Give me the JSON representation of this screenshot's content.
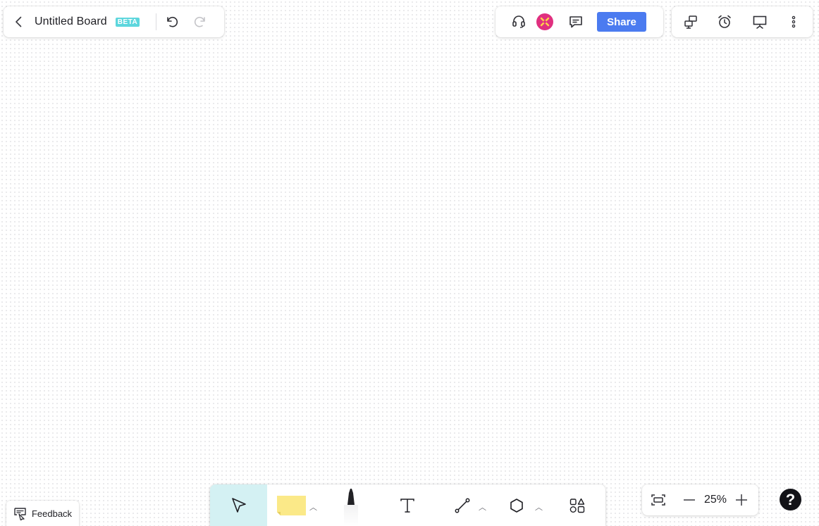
{
  "board": {
    "title": "Untitled Board",
    "badge": "BETA",
    "back_icon": "chevron-left-icon",
    "undo_icon": "undo-icon",
    "redo_icon": "redo-icon"
  },
  "collab": {
    "support_icon": "headset-icon",
    "avatar_icon": "avatar-icon",
    "comments_icon": "comment-icon",
    "share_label": "Share"
  },
  "tools_menu": {
    "icons": [
      "pin-transfer-icon",
      "alarm-clock-icon",
      "presentation-icon",
      "more-vertical-icon"
    ]
  },
  "toolbar": {
    "tools": [
      {
        "name": "select",
        "icon": "cursor-arrow-icon",
        "active": true
      },
      {
        "name": "sticky-note",
        "icon": "sticky-note-icon",
        "has_menu": true
      },
      {
        "name": "pen",
        "icon": "marker-icon"
      },
      {
        "name": "text",
        "icon": "text-icon"
      },
      {
        "name": "connector",
        "icon": "line-connector-icon",
        "has_menu": true
      },
      {
        "name": "shape",
        "icon": "hexagon-icon",
        "has_menu": true
      },
      {
        "name": "templates",
        "icon": "shapes-library-icon"
      }
    ]
  },
  "zoom": {
    "level": "25%",
    "fit_icon": "fit-to-screen-icon",
    "minus_icon": "minus-icon",
    "plus_icon": "plus-icon"
  },
  "help": {
    "label": "?"
  },
  "feedback": {
    "label": "Feedback",
    "icon": "feedback-icon"
  },
  "colors": {
    "accent": "#4b7bf0",
    "active_tool_bg": "#d4f1f3",
    "beta_badge": "#5dd6dd",
    "sticky_yellow": "#fbe988",
    "avatar": "#e0307f"
  }
}
